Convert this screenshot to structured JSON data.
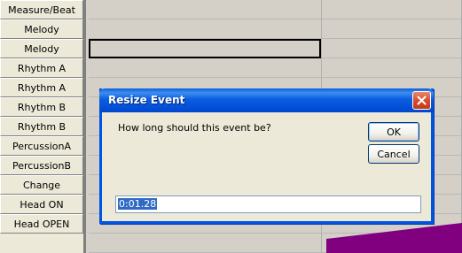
{
  "tracks": [
    "Measure/Beat",
    "Melody",
    "Melody",
    "Rhythm A",
    "Rhythm A",
    "Rhythm B",
    "Rhythm B",
    "PercussionA",
    "PercussionB",
    "Change",
    "Head ON",
    "Head OPEN"
  ],
  "dialog": {
    "title": "Resize Event",
    "prompt": "How long should this event be?",
    "ok_label": "OK",
    "cancel_label": "Cancel",
    "duration_value": "0:01.28"
  },
  "colors": {
    "event_bar": "#800080",
    "title_bar": "#0054e3"
  },
  "icons": {
    "close": "close-icon"
  }
}
